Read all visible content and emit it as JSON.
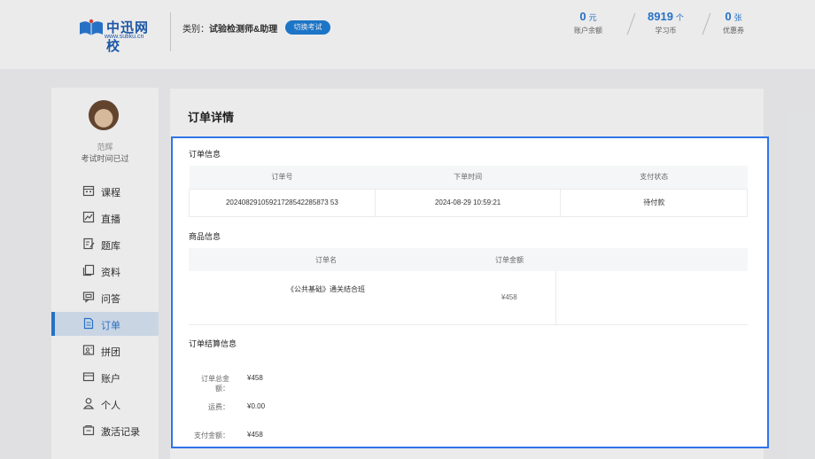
{
  "header": {
    "logo_name": "中迅网校",
    "logo_url": "www.sutiku.cn",
    "category_label": "类别：",
    "category_value": "试验检测师&助理",
    "switch_button": "切换考试",
    "stats": [
      {
        "num": "0",
        "unit": "元",
        "label": "账户余额"
      },
      {
        "num": "8919",
        "unit": "个",
        "label": "学习币"
      },
      {
        "num": "0",
        "unit": "张",
        "label": "优惠券"
      }
    ]
  },
  "sidebar": {
    "username": "范辉",
    "exam_note": "考试时间已过",
    "items": [
      {
        "label": "课程",
        "icon": "calendar-icon"
      },
      {
        "label": "直播",
        "icon": "chart-icon"
      },
      {
        "label": "题库",
        "icon": "edit-doc-icon"
      },
      {
        "label": "资料",
        "icon": "copy-icon"
      },
      {
        "label": "问答",
        "icon": "chat-icon"
      },
      {
        "label": "订单",
        "icon": "order-icon"
      },
      {
        "label": "拼团",
        "icon": "group-icon"
      },
      {
        "label": "账户",
        "icon": "wallet-icon"
      },
      {
        "label": "个人",
        "icon": "user-icon"
      },
      {
        "label": "激活记录",
        "icon": "activate-icon"
      }
    ],
    "active_index": 5
  },
  "main": {
    "title": "订单详情",
    "order_info": {
      "title": "订单信息",
      "headers": [
        "订单号",
        "下单时间",
        "支付状态"
      ],
      "row": [
        "20240829105921728542285873 53",
        "2024-08-29 10:59:21",
        "待付款"
      ]
    },
    "goods_info": {
      "title": "商品信息",
      "headers": [
        "订单名",
        "订单金额"
      ],
      "row": [
        "《公共基础》通关结合班",
        "¥458"
      ]
    },
    "settle_info": {
      "title": "订单结算信息",
      "rows": [
        {
          "k": "订单总金额：",
          "v": "¥458"
        },
        {
          "k": "运费：",
          "v": "¥0.00"
        },
        {
          "k": "支付金额：",
          "v": "¥458"
        }
      ]
    }
  },
  "colors": {
    "accent": "#2a7bd6",
    "highlight_border": "#2f74e8"
  }
}
